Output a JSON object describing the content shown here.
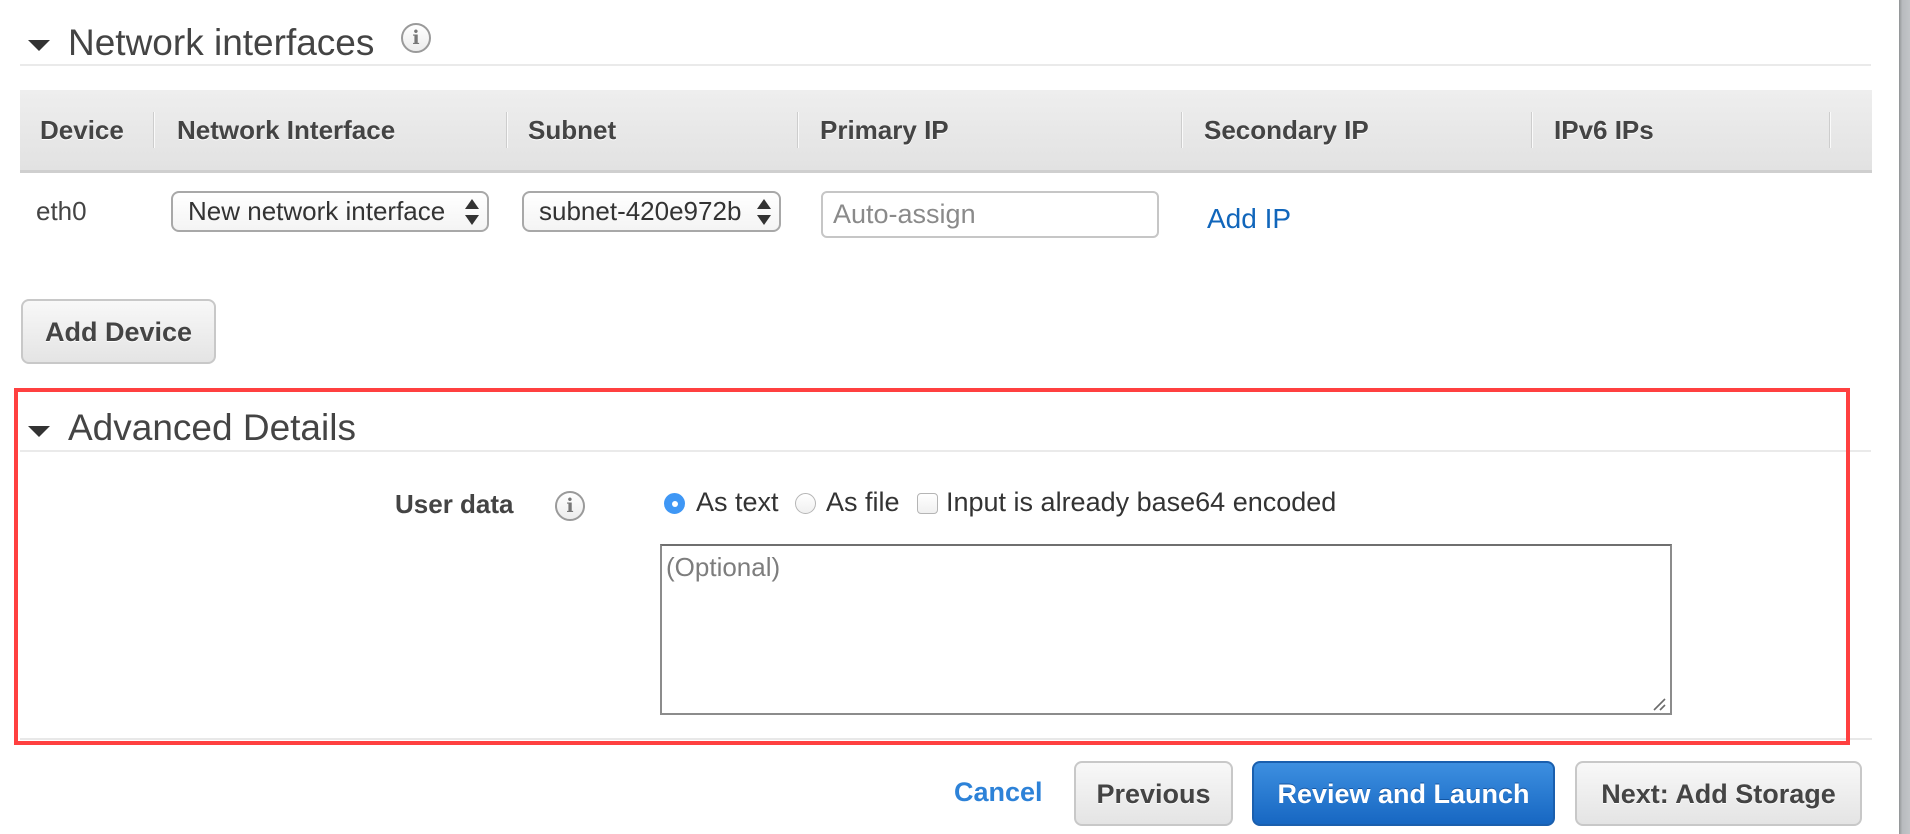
{
  "network_interfaces": {
    "title": "Network interfaces",
    "info_icon": "info-icon",
    "columns": [
      "Device",
      "Network Interface",
      "Subnet",
      "Primary IP",
      "Secondary IP",
      "IPv6 IPs"
    ],
    "rows": [
      {
        "device": "eth0",
        "network_interface": "New network interface",
        "subnet": "subnet-420e972b",
        "primary_ip_value": "",
        "primary_ip_placeholder": "Auto-assign",
        "secondary_ip_link": "Add IP",
        "ipv6_ips": ""
      }
    ],
    "add_device_label": "Add Device"
  },
  "advanced_details": {
    "title": "Advanced Details",
    "user_data": {
      "label": "User data",
      "info_icon": "info-icon",
      "options": [
        {
          "label": "As text",
          "type": "radio",
          "checked": true
        },
        {
          "label": "As file",
          "type": "radio",
          "checked": false
        },
        {
          "label": "Input is already base64 encoded",
          "type": "checkbox",
          "checked": false
        }
      ],
      "textarea_value": "",
      "textarea_placeholder": "(Optional)"
    },
    "highlight_color": "#ff4040"
  },
  "footer": {
    "cancel_label": "Cancel",
    "previous_label": "Previous",
    "review_launch_label": "Review and Launch",
    "next_label": "Next: Add Storage"
  },
  "colors": {
    "link": "#1166bb",
    "cancel_link": "#2d82d8",
    "primary_button": "#1a6fc8",
    "radio_checked": "#3f97f5"
  }
}
